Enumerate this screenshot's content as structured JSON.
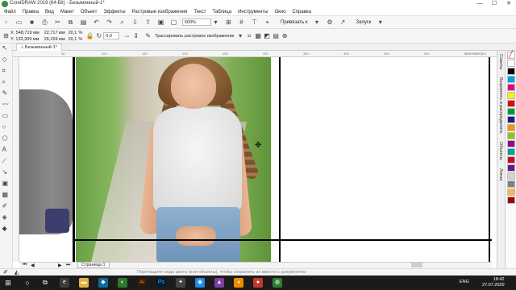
{
  "window": {
    "title": "CorelDRAW 2019 (64-Bit) - Безымянный-1*",
    "min": "—",
    "max": "☐",
    "close": "✕"
  },
  "menu": [
    "Файл",
    "Правка",
    "Вид",
    "Макет",
    "Объект",
    "Эффекты",
    "Растровые изображения",
    "Текст",
    "Таблица",
    "Инструменты",
    "Окно",
    "Справка"
  ],
  "toolbar": {
    "zoom": "600%",
    "snap": "Привязать к",
    "launch": "Запуск"
  },
  "propbar": {
    "x": "X: 548,719 мм",
    "y": "Y: 132,309 мм",
    "w": "22,717 мм",
    "h": "26,159 мм",
    "sx": "20,1",
    "sy": "20,1",
    "pct": "%",
    "angle": "0,0",
    "trace": "Трассировать растровое изображение"
  },
  "doc_tab": "Безымянный-1*",
  "ruler_label": "миллиметры",
  "ruler_ticks": [
    "50",
    "100",
    "150",
    "200",
    "250",
    "300",
    "350",
    "400",
    "450",
    "500",
    "550"
  ],
  "page_tab": "Страница 1",
  "status_hint": "Перетащите сюда цвета (или объекты), чтобы сохранить их вместе с документом",
  "docker_tabs": [
    "Советы",
    "Выровнять и распределить",
    "Объекты",
    "Линза"
  ],
  "palette": [
    "#ffffff",
    "#000000",
    "#00a0e9",
    "#e4007f",
    "#fff100",
    "#e60012",
    "#009944",
    "#1d2088",
    "#f39800",
    "#8fc31f",
    "#920783",
    "#00a29a",
    "#c30d23",
    "#601986",
    "#d3d3d3",
    "#7f7f7f",
    "#f8b551",
    "#a40000"
  ],
  "taskbar": {
    "lang": "ENG",
    "time": "18:42",
    "date": "27.07.2020"
  }
}
